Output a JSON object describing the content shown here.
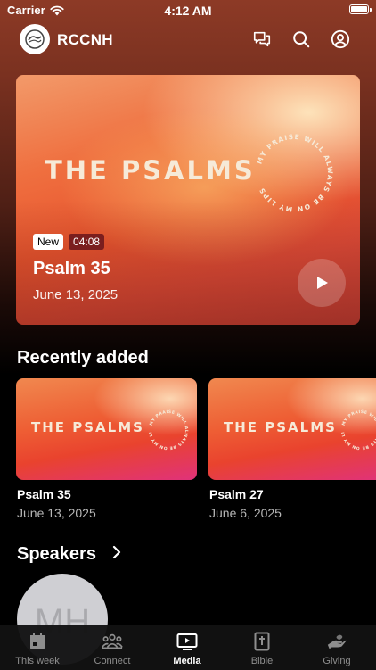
{
  "status_bar": {
    "carrier": "Carrier",
    "time": "4:12 AM"
  },
  "header": {
    "brand": "RCCNH",
    "icons": [
      "chat-icon",
      "search-icon",
      "account-icon"
    ]
  },
  "hero": {
    "artwork_title": "THE PSALMS",
    "artwork_ring_text": "MY PRAISE WILL ALWAYS BE ON MY LIPS",
    "badge_new": "New",
    "duration": "04:08",
    "title": "Psalm 35",
    "date": "June 13, 2025"
  },
  "recently_added": {
    "title": "Recently added",
    "items": [
      {
        "artwork_title": "THE PSALMS",
        "title": "Psalm 35",
        "date": "June 13, 2025"
      },
      {
        "artwork_title": "THE PSALMS",
        "title": "Psalm 27",
        "date": "June 6, 2025"
      }
    ]
  },
  "speakers": {
    "title": "Speakers",
    "items": [
      {
        "initials": "MH"
      }
    ]
  },
  "tabbar": {
    "active": "Media",
    "tabs": [
      {
        "label": "This week",
        "icon": "calendar-icon"
      },
      {
        "label": "Connect",
        "icon": "people-icon"
      },
      {
        "label": "Media",
        "icon": "tv-play-icon"
      },
      {
        "label": "Bible",
        "icon": "bible-icon"
      },
      {
        "label": "Giving",
        "icon": "giving-hand-icon"
      }
    ]
  },
  "colors": {
    "background": "#000000",
    "header_gradient_top": "#8d3a26",
    "artwork_orange": "#ee5e34",
    "artwork_pink": "#e0327a",
    "duration_badge": "#7a1e1e",
    "secondary_text": "#b7b7b7",
    "tab_inactive": "#8e8e8e"
  }
}
